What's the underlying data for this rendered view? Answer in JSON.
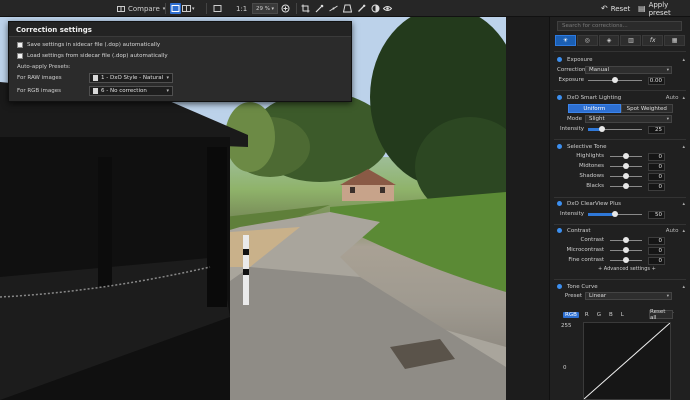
{
  "toolbar": {
    "compare_label": "Compare",
    "zoom_ratio": "1:1",
    "zoom_value": "29 %",
    "reset_label": "Reset",
    "apply_preset_label": "Apply preset"
  },
  "popup": {
    "title": "Correction settings",
    "save_settings_label": "Save settings in sidecar file (.dop) automatically",
    "load_settings_label": "Load settings from sidecar file (.dop) automatically",
    "auto_apply_label": "Auto-apply Presets:",
    "raw_label": "For RAW images",
    "raw_value": "1 - DxO Style - Natural",
    "rgb_label": "For RGB images",
    "rgb_value": "6 - No correction"
  },
  "panel": {
    "search_placeholder": "Search for corrections...",
    "tabs": [
      {
        "icon": "sun-icon"
      },
      {
        "icon": "color-palette-icon"
      },
      {
        "icon": "detail-icon"
      },
      {
        "icon": "geometry-icon"
      },
      {
        "icon": "fx-icon",
        "label": "fx"
      },
      {
        "icon": "local-adjust-icon"
      }
    ],
    "exposure": {
      "title": "Exposure",
      "correction_label": "Correction",
      "correction_value": "Manual",
      "exposure_label": "Exposure",
      "exposure_value": "0.00",
      "exposure_level": 0.5
    },
    "smart_lighting": {
      "title": "DxO Smart Lighting",
      "auto_label": "Auto",
      "uniform_label": "Uniform",
      "spot_label": "Spot Weighted",
      "mode_label": "Mode",
      "mode_value": "Slight",
      "intensity_label": "Intensity",
      "intensity_value": "25",
      "intensity_level": 0.25
    },
    "selective_tone": {
      "title": "Selective Tone",
      "rows": [
        {
          "label": "Highlights",
          "value": "0",
          "level": 0.5
        },
        {
          "label": "Midtones",
          "value": "0",
          "level": 0.5
        },
        {
          "label": "Shadows",
          "value": "0",
          "level": 0.5
        },
        {
          "label": "Blacks",
          "value": "0",
          "level": 0.5
        }
      ]
    },
    "clearview": {
      "title": "DxO ClearView Plus",
      "intensity_label": "Intensity",
      "intensity_value": "50",
      "intensity_level": 0.5
    },
    "contrast": {
      "title": "Contrast",
      "auto_label": "Auto",
      "rows": [
        {
          "label": "Contrast",
          "value": "0",
          "level": 0.5
        },
        {
          "label": "Microcontrast",
          "value": "0",
          "level": 0.5
        },
        {
          "label": "Fine contrast",
          "value": "0",
          "level": 0.5
        }
      ],
      "advanced_label": "+ Advanced settings +"
    },
    "tone_curve": {
      "title": "Tone Curve",
      "preset_label": "Preset",
      "preset_value": "Linear",
      "channels": [
        "RGB",
        "R",
        "G",
        "B",
        "L"
      ],
      "reset_all_label": "Reset all",
      "max_value": "255",
      "min_value": "0"
    }
  },
  "colors": {
    "accent": "#2d6fd1",
    "panel_bg": "#202020",
    "toolbar_bg": "#262626"
  }
}
